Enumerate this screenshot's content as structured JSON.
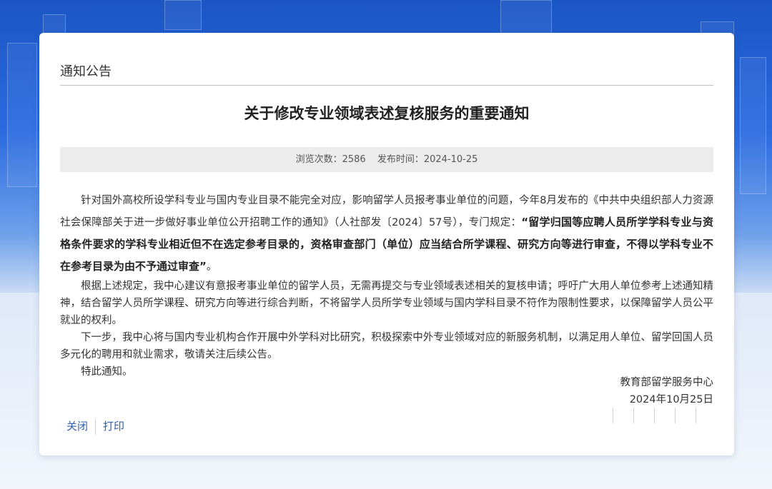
{
  "section": "通知公告",
  "title": "关于修改专业领域表述复核服务的重要通知",
  "meta": {
    "views_label": "浏览次数：",
    "views": "2586",
    "date_label": "发布时间：",
    "date": "2024-10-25"
  },
  "body": {
    "p1_pre": "针对国外高校所设学科专业与国内专业目录不能完全对应，影响留学人员报考事业单位的问题，今年8月发布的《中共中央组织部人力资源社会保障部关于进一步做好事业单位公开招聘工作的通知》（人社部发〔2024〕57号），专门规定：",
    "p1_bold": "“留学归国等应聘人员所学学科专业与资格条件要求的学科专业相近但不在选定参考目录的，资格审查部门（单位）应当结合所学课程、研究方向等进行审查，不得以学科专业不在参考目录为由不予通过审查”",
    "p1_post": "。",
    "p2": "根据上述规定，我中心建议有意报考事业单位的留学人员，无需再提交与专业领域表述相关的复核申请；呼吁广大用人单位参考上述通知精神，结合留学人员所学课程、研究方向等进行综合判断，不将留学人员所学专业领域与国内学科目录不符作为限制性要求，以保障留学人员公平就业的权利。",
    "p3": "下一步，我中心将与国内专业机构合作开展中外学科对比研究，积极探索中外专业领域对应的新服务机制，以满足用人单位、留学回国人员多元化的聘用和就业需求，敬请关注后续公告。",
    "p4": "特此通知。"
  },
  "signature": {
    "org": "教育部留学服务中心",
    "date": "2024年10月25日"
  },
  "actions": {
    "close": "关闭",
    "print": "打印"
  },
  "colors": {
    "link": "#2f5fb0",
    "banner": "#2a6be0"
  }
}
